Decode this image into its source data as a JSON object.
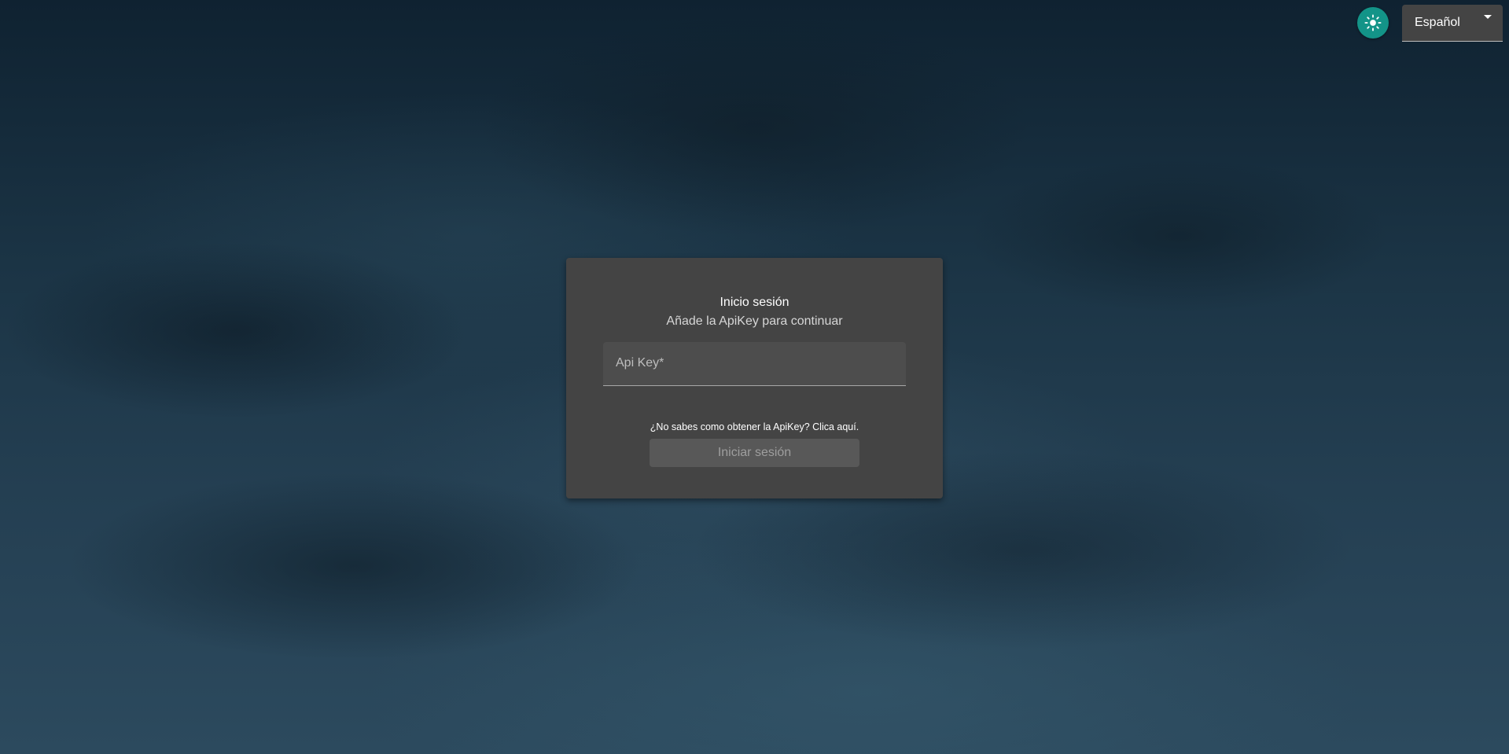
{
  "header": {
    "theme_toggle_icon": "sun-icon",
    "theme_toggle_color": "#139488",
    "language": {
      "selected": "Español"
    }
  },
  "login": {
    "title": "Inicio sesión",
    "subtitle": "Añade la ApiKey para continuar",
    "api_key_field": {
      "label": "Api Key*",
      "value": ""
    },
    "help_link": "¿No sabes como obtener la ApiKey? Clica aquí.",
    "submit_label": "Iniciar sesión",
    "submit_disabled": true
  },
  "colors": {
    "card_background": "#444444",
    "accent": "#139488"
  }
}
